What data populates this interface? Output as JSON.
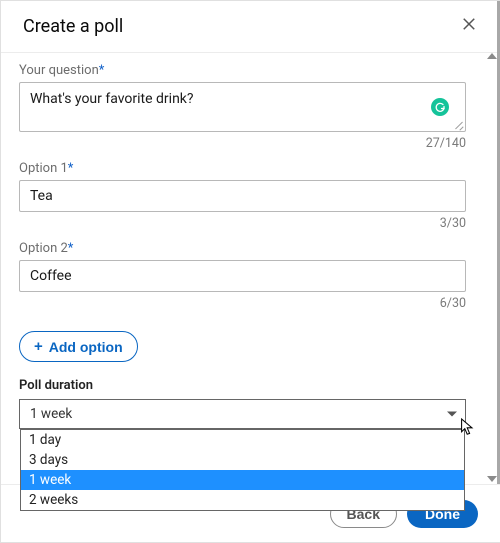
{
  "header": {
    "title": "Create a poll"
  },
  "question": {
    "label": "Your question",
    "required_mark": "*",
    "value": "What's your favorite drink?",
    "counter": "27/140"
  },
  "options": [
    {
      "label": "Option 1",
      "required_mark": "*",
      "value": "Tea",
      "counter": "3/30"
    },
    {
      "label": "Option 2",
      "required_mark": "*",
      "value": "Coffee",
      "counter": "6/30"
    }
  ],
  "add_option": {
    "icon": "+",
    "label": "Add option"
  },
  "duration": {
    "label": "Poll duration",
    "selected": "1 week",
    "items": [
      "1 day",
      "3 days",
      "1 week",
      "2 weeks"
    ],
    "highlighted_index": 2
  },
  "footer": {
    "back": "Back",
    "done": "Done"
  }
}
